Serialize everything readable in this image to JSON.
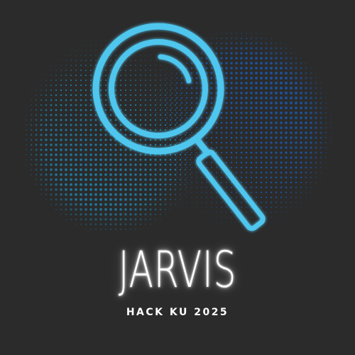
{
  "logo": {
    "title": "JARVIS",
    "subtitle": "HACK KU 2025",
    "icon": "magnifying-glass-icon"
  },
  "colors": {
    "background": "#2b2b2b",
    "accent": "#4fc6ee",
    "dot_left": "#1f7fa8",
    "dot_right": "#1a56a6",
    "title_glow": "#ffffff"
  }
}
